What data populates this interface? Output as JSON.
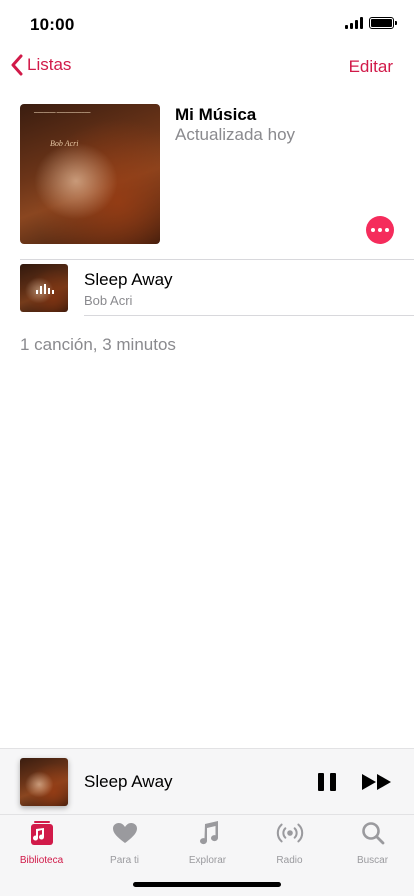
{
  "status_bar": {
    "time": "10:00"
  },
  "nav": {
    "back_label": "Listas",
    "edit_label": "Editar"
  },
  "playlist": {
    "title": "Mi Música",
    "subtitle": "Actualizada hoy",
    "artwork_text": "Bob Acri",
    "more_icon": "ellipsis-icon"
  },
  "songs": [
    {
      "title": "Sleep Away",
      "artist": "Bob Acri",
      "playing": true
    }
  ],
  "summary": "1 canción, 3 minutos",
  "mini_player": {
    "title": "Sleep Away",
    "state": "playing"
  },
  "tabs": [
    {
      "label": "Biblioteca",
      "icon": "library-icon",
      "active": true
    },
    {
      "label": "Para ti",
      "icon": "heart-icon",
      "active": false
    },
    {
      "label": "Explorar",
      "icon": "music-note-icon",
      "active": false
    },
    {
      "label": "Radio",
      "icon": "radio-icon",
      "active": false
    },
    {
      "label": "Buscar",
      "icon": "search-icon",
      "active": false
    }
  ],
  "colors": {
    "accent": "#d11a49",
    "more_button": "#f52c5c",
    "inactive_tab": "#9a9a9e",
    "secondary_text": "#8a8a8e"
  }
}
